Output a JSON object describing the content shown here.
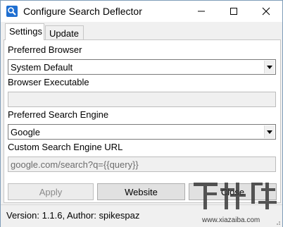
{
  "window": {
    "title": "Configure Search Deflector",
    "icon": "search-deflector-app-icon"
  },
  "tabs": [
    {
      "label": "Settings",
      "selected": true
    },
    {
      "label": "Update",
      "selected": false
    }
  ],
  "settings": {
    "browser_label": "Preferred Browser",
    "browser_value": "System Default",
    "executable_label": "Browser Executable",
    "executable_value": "",
    "engine_label": "Preferred Search Engine",
    "engine_value": "Google",
    "custom_url_label": "Custom Search Engine URL",
    "custom_url_value": "google.com/search?q={{query}}"
  },
  "buttons": {
    "apply": "Apply",
    "website": "Website",
    "close": "Close"
  },
  "status": {
    "text": "Version: 1.1.6, Author: spikespaz"
  },
  "watermark": {
    "text": "下载吧",
    "url": "www.xiazaiba.com"
  },
  "colors": {
    "window_bg": "#f0f0f0",
    "panel_bg": "#ffffff",
    "icon_blue": "#1f6fd1"
  }
}
